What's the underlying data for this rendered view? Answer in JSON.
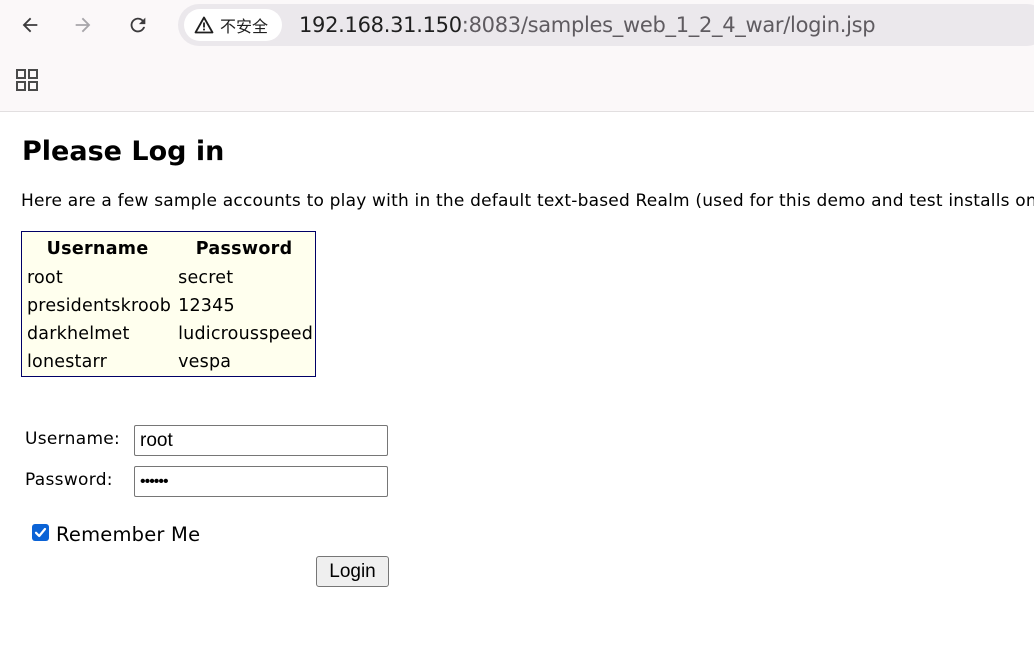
{
  "browser": {
    "security_label": "不安全",
    "url_host": "192.168.31.150",
    "url_rest": ":8083/samples_web_1_2_4_war/login.jsp"
  },
  "page": {
    "title": "Please Log in",
    "intro": "Here are a few sample accounts to play with in the default text-based Realm (used for this demo and test installs only)."
  },
  "accounts_table": {
    "headers": [
      "Username",
      "Password"
    ],
    "rows": [
      [
        "root",
        "secret"
      ],
      [
        "presidentskroob",
        "12345"
      ],
      [
        "darkhelmet",
        "ludicrousspeed"
      ],
      [
        "lonestarr",
        "vespa"
      ]
    ]
  },
  "form": {
    "username_label": "Username:",
    "username_value": "root",
    "password_label": "Password:",
    "password_value": "secret",
    "remember_label": "Remember Me",
    "remember_checked": true,
    "login_label": "Login"
  },
  "colors": {
    "table_bg": "#ffffee",
    "table_border": "#000066",
    "checkbox_accent": "#0b63d6"
  },
  "icons": [
    "back-arrow-icon",
    "forward-arrow-icon",
    "reload-icon",
    "warning-icon",
    "apps-grid-icon",
    "checkmark-icon"
  ]
}
